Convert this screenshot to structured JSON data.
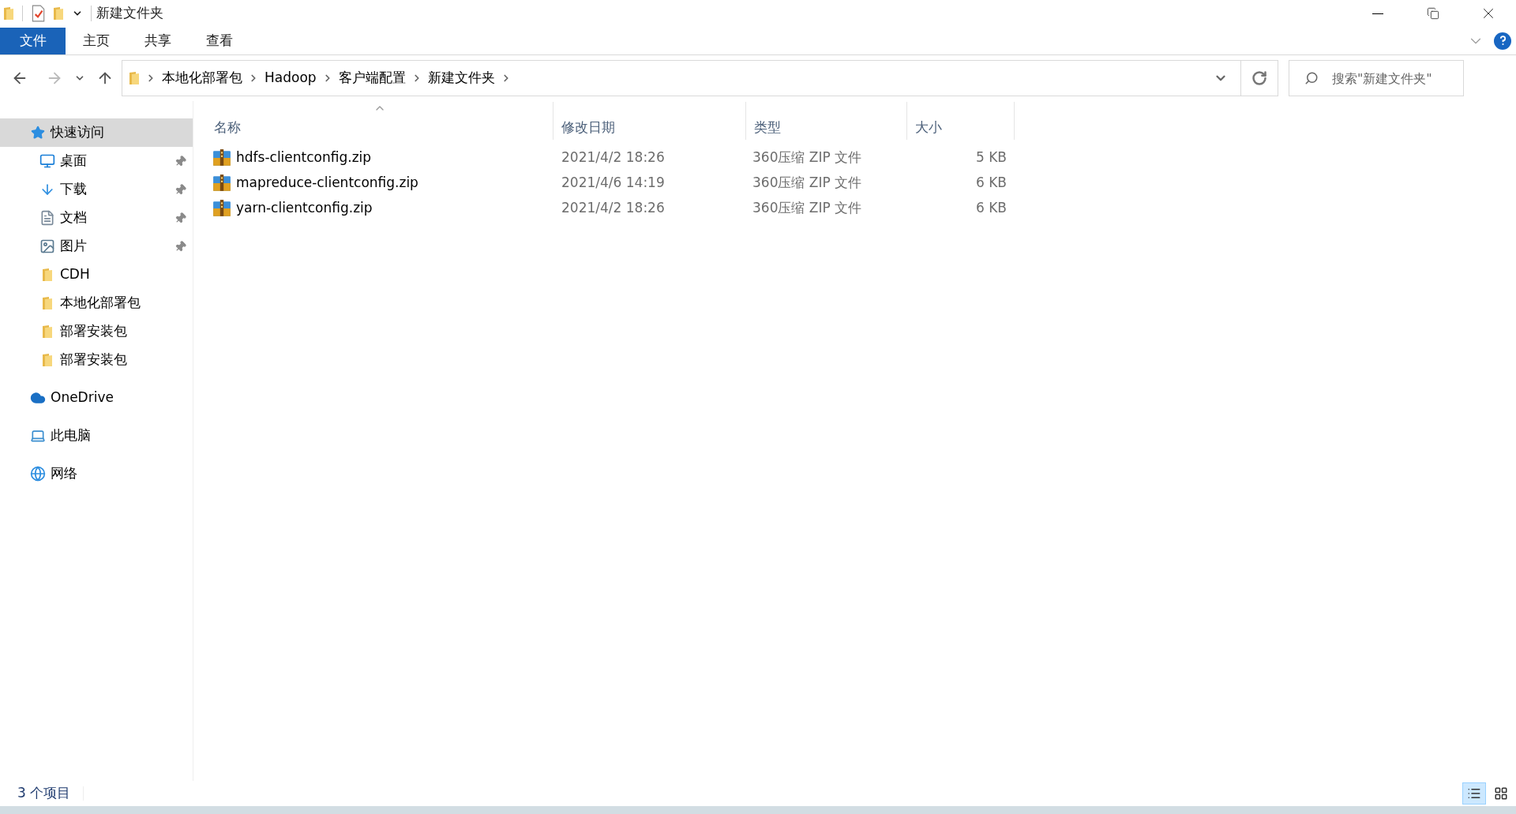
{
  "window": {
    "title": "新建文件夹"
  },
  "ribbon_tabs": [
    {
      "label": "文件",
      "kind": "file"
    },
    {
      "label": "主页",
      "kind": "plain"
    },
    {
      "label": "共享",
      "kind": "plain"
    },
    {
      "label": "查看",
      "kind": "plain"
    }
  ],
  "address_bar": {
    "crumbs": [
      "本地化部署包",
      "Hadoop",
      "客户端配置",
      "新建文件夹"
    ]
  },
  "search": {
    "placeholder": "搜索\"新建文件夹\""
  },
  "sidebar": {
    "items": [
      {
        "label": "快速访问",
        "kind": "quick",
        "selected": true,
        "children": [
          {
            "label": "桌面",
            "kind": "desktop",
            "pinned": true,
            "selected": false
          },
          {
            "label": "下载",
            "kind": "download",
            "pinned": true,
            "selected": false
          },
          {
            "label": "文档",
            "kind": "docs",
            "pinned": true,
            "selected": false
          },
          {
            "label": "图片",
            "kind": "pictures",
            "pinned": true,
            "selected": false
          },
          {
            "label": "CDH",
            "kind": "folder",
            "pinned": false,
            "selected": false
          },
          {
            "label": "本地化部署包",
            "kind": "folder",
            "pinned": false,
            "selected": false
          },
          {
            "label": "部署安装包",
            "kind": "folder",
            "pinned": false,
            "selected": false
          },
          {
            "label": "部署安装包",
            "kind": "folder",
            "pinned": false,
            "selected": false
          }
        ]
      },
      {
        "label": "OneDrive",
        "kind": "cloud",
        "selected": false
      },
      {
        "label": "此电脑",
        "kind": "pc",
        "selected": false
      },
      {
        "label": "网络",
        "kind": "network",
        "selected": false
      }
    ]
  },
  "table": {
    "columns": [
      {
        "label": "名称",
        "sorted": true
      },
      {
        "label": "修改日期",
        "sorted": false
      },
      {
        "label": "类型",
        "sorted": false
      },
      {
        "label": "大小",
        "sorted": false
      }
    ],
    "rows": [
      {
        "name": "hdfs-clientconfig.zip",
        "modified": "2021/4/2 18:26",
        "type": "360压缩 ZIP 文件",
        "size": "5 KB"
      },
      {
        "name": "mapreduce-clientconfig.zip",
        "modified": "2021/4/6 14:19",
        "type": "360压缩 ZIP 文件",
        "size": "6 KB"
      },
      {
        "name": "yarn-clientconfig.zip",
        "modified": "2021/4/2 18:26",
        "type": "360压缩 ZIP 文件",
        "size": "6 KB"
      }
    ]
  },
  "status_bar": {
    "count": "3 个项目",
    "views": [
      {
        "kind": "details",
        "selected": true
      },
      {
        "kind": "tiles",
        "selected": false
      }
    ]
  }
}
